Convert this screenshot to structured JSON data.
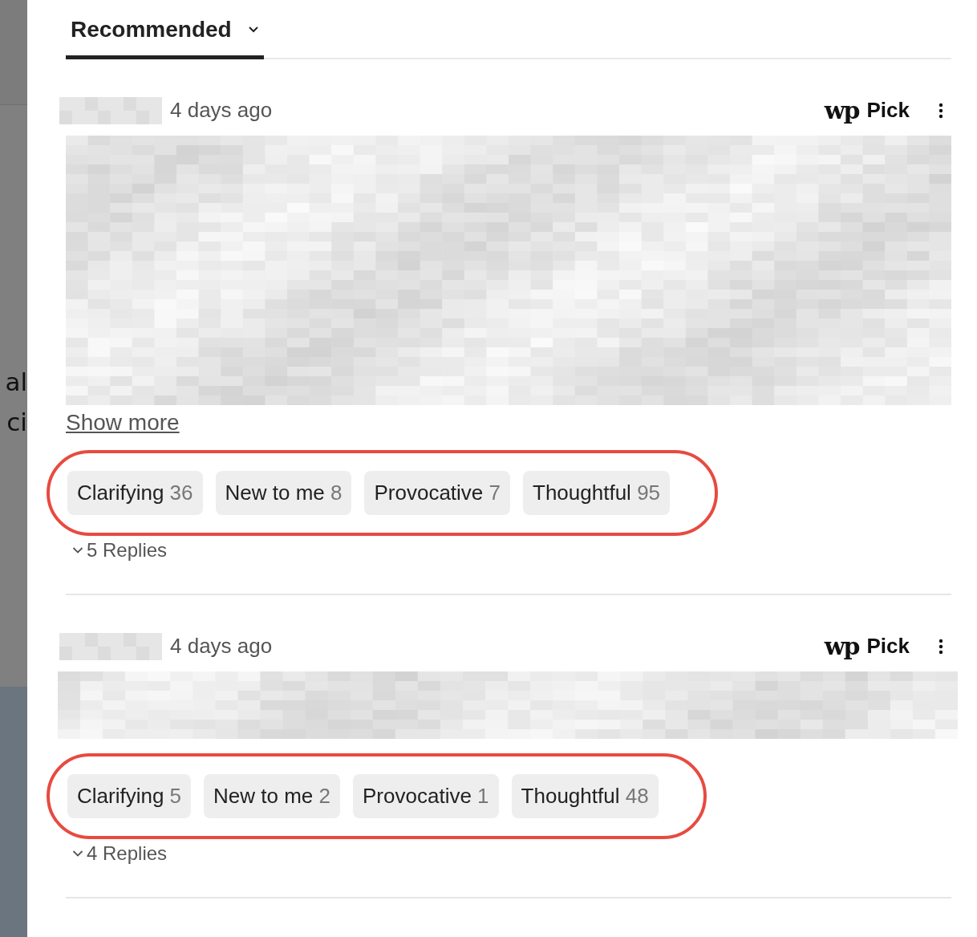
{
  "background_page": {
    "text_lines": [
      "al",
      "ci"
    ]
  },
  "sort_tab": {
    "label": "Recommended",
    "selected": true
  },
  "comments": [
    {
      "time": "4 days ago",
      "pick_logo": "wp",
      "pick_label": "Pick",
      "show_more": "Show more",
      "highlighted": true,
      "reactions": [
        {
          "label": "Clarifying",
          "count": "36"
        },
        {
          "label": "New to me",
          "count": "8"
        },
        {
          "label": "Provocative",
          "count": "7"
        },
        {
          "label": "Thoughtful",
          "count": "95"
        }
      ],
      "replies": "5 Replies"
    },
    {
      "time": "4 days ago",
      "pick_logo": "wp",
      "pick_label": "Pick",
      "highlighted": true,
      "reactions": [
        {
          "label": "Clarifying",
          "count": "5"
        },
        {
          "label": "New to me",
          "count": "2"
        },
        {
          "label": "Provocative",
          "count": "1"
        },
        {
          "label": "Thoughtful",
          "count": "48"
        }
      ],
      "replies": "4 Replies"
    }
  ]
}
